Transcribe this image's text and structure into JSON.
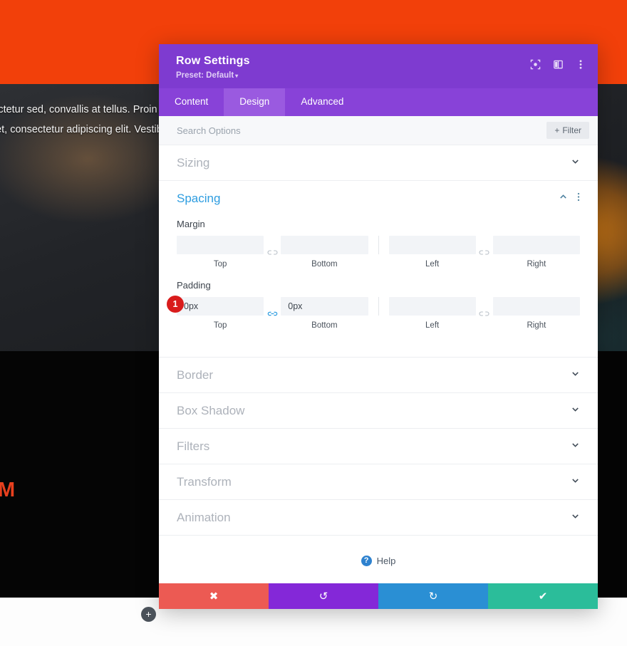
{
  "background": {
    "hero_lines": [
      "sectetur sed, convallis at tellus. Proin",
      "met, consectetur adipiscing elit. Vestibu"
    ],
    "cta_text": "OM",
    "add_module_label": "+",
    "colors": {
      "orange_bar": "#f2400a",
      "cta_red": "#e8401e",
      "black_band": "#050505"
    }
  },
  "modal": {
    "title": "Row Settings",
    "preset_label": "Preset: Default",
    "preset_caret": "▾",
    "header_icons": [
      {
        "name": "focus-icon"
      },
      {
        "name": "split-view-icon"
      },
      {
        "name": "more-options-icon"
      }
    ],
    "tabs": [
      {
        "label": "Content",
        "active": false
      },
      {
        "label": "Design",
        "active": true
      },
      {
        "label": "Advanced",
        "active": false
      }
    ],
    "search": {
      "placeholder": "Search Options",
      "value": ""
    },
    "filter_button": {
      "plus": "+",
      "label": "Filter"
    },
    "sections": [
      {
        "title": "Sizing",
        "open": false
      },
      {
        "title": "Spacing",
        "open": true
      },
      {
        "title": "Border",
        "open": false
      },
      {
        "title": "Box Shadow",
        "open": false
      },
      {
        "title": "Filters",
        "open": false
      },
      {
        "title": "Transform",
        "open": false
      },
      {
        "title": "Animation",
        "open": false
      }
    ],
    "spacing": {
      "margin": {
        "label": "Margin",
        "fields": [
          {
            "sub": "Top",
            "value": "",
            "placeholder": ""
          },
          {
            "sub": "Bottom",
            "value": "",
            "placeholder": ""
          },
          {
            "sub": "Left",
            "value": "",
            "placeholder": ""
          },
          {
            "sub": "Right",
            "value": "",
            "placeholder": ""
          }
        ],
        "link_left_active": false,
        "link_right_active": false
      },
      "padding": {
        "label": "Padding",
        "badge": "1",
        "fields": [
          {
            "sub": "Top",
            "value": "0px",
            "placeholder": ""
          },
          {
            "sub": "Bottom",
            "value": "0px",
            "placeholder": ""
          },
          {
            "sub": "Left",
            "value": "",
            "placeholder": ""
          },
          {
            "sub": "Right",
            "value": "",
            "placeholder": ""
          }
        ],
        "link_left_active": true,
        "link_right_active": false
      }
    },
    "help": {
      "icon_glyph": "?",
      "label": "Help"
    },
    "footer": [
      {
        "name": "cancel",
        "glyph": "✖"
      },
      {
        "name": "undo",
        "glyph": "↺"
      },
      {
        "name": "redo",
        "glyph": "↻"
      },
      {
        "name": "save",
        "glyph": "✔"
      }
    ],
    "colors": {
      "header_purple": "#7e3bd0",
      "tabs_purple": "#8842d8",
      "active_tab_purple": "#9a5ae0",
      "section_active_blue": "#2e9de0",
      "badge_red": "#d91c1c",
      "cancel": "#ec5a53",
      "undo": "#8428d8",
      "redo": "#2a8fd4",
      "save": "#2bbd9a"
    }
  }
}
